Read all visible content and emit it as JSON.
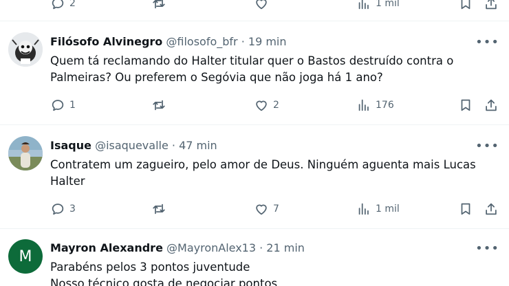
{
  "posts": [
    {
      "stats": {
        "replies": "2",
        "likes": "",
        "views": "1 mil"
      }
    },
    {
      "name": "Filósofo Alvinegro",
      "handle": "@filosofo_bfr",
      "time": "· 19 min",
      "text": "Quem tá reclamando do Halter titular quer o Bastos destruído contra o Palmeiras? Ou preferem o Segóvia que não joga há 1 ano?",
      "stats": {
        "replies": "1",
        "likes": "2",
        "views": "176"
      }
    },
    {
      "name": "Isaque",
      "handle": "@isaquevalle",
      "time": "· 47 min",
      "text": "Contratem um zagueiro, pelo amor de Deus. Ninguém aguenta mais Lucas Halter",
      "stats": {
        "replies": "3",
        "likes": "7",
        "views": "1 mil"
      }
    },
    {
      "name": "Mayron Alexandre",
      "handle": "@MayronAlex13",
      "time": "· 21 min",
      "avatar_letter": "M",
      "avatar_color": "#0d6b3a",
      "text_lines": [
        "Parabéns pelos 3 pontos juventude",
        "Nosso técnico gosta de negociar pontos"
      ]
    }
  ],
  "more_glyph": "•••",
  "icons": [
    "reply-icon",
    "repost-icon",
    "like-icon",
    "views-icon",
    "bookmark-icon",
    "share-icon"
  ]
}
